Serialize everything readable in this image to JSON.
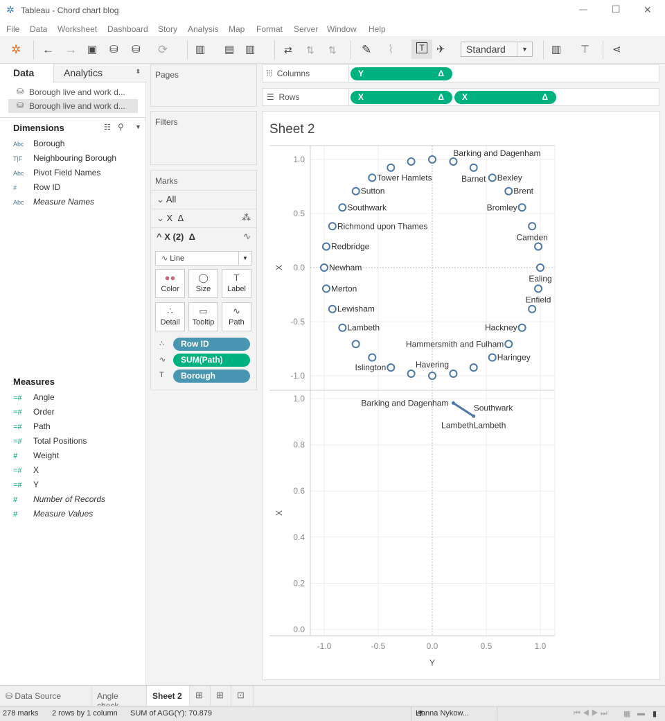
{
  "window": {
    "title": "Tableau - Chord chart blog",
    "minimize": "—",
    "maximize": "☐",
    "close": "✕"
  },
  "menu": [
    "File",
    "Data",
    "Worksheet",
    "Dashboard",
    "Story",
    "Analysis",
    "Map",
    "Format",
    "Server",
    "Window",
    "Help"
  ],
  "toolbar": {
    "fit_select": "Standard"
  },
  "data_pane": {
    "tabs": {
      "data": "Data",
      "analytics": "Analytics"
    },
    "datasources": [
      "Borough live and work d...",
      "Borough live and work d..."
    ],
    "dimensions_title": "Dimensions",
    "dimensions": [
      {
        "icon": "Abc",
        "label": "Borough",
        "italic": false
      },
      {
        "icon": "T|F",
        "label": "Neighbouring Borough",
        "italic": false
      },
      {
        "icon": "Abc",
        "label": "Pivot Field Names",
        "italic": false
      },
      {
        "icon": "#",
        "label": "Row ID",
        "italic": false
      },
      {
        "icon": "Abc",
        "label": "Measure Names",
        "italic": true
      }
    ],
    "measures_title": "Measures",
    "measures": [
      {
        "icon": "=#",
        "label": "Angle",
        "italic": false
      },
      {
        "icon": "=#",
        "label": "Order",
        "italic": false
      },
      {
        "icon": "=#",
        "label": "Path",
        "italic": false
      },
      {
        "icon": "=#",
        "label": "Total Positions",
        "italic": false
      },
      {
        "icon": "#",
        "label": "Weight",
        "italic": false
      },
      {
        "icon": "=#",
        "label": "X",
        "italic": false
      },
      {
        "icon": "=#",
        "label": "Y",
        "italic": false
      },
      {
        "icon": "#",
        "label": "Number of Records",
        "italic": true
      },
      {
        "icon": "#",
        "label": "Measure Values",
        "italic": true
      }
    ]
  },
  "cards": {
    "pages": "Pages",
    "filters": "Filters",
    "marks": "Marks"
  },
  "marks": {
    "all": "All",
    "x1": "X",
    "x2": "X (2)",
    "delta": "Δ",
    "mark_type": "Line",
    "buttons": [
      "Color",
      "Size",
      "Label",
      "Detail",
      "Tooltip",
      "Path"
    ],
    "pills": [
      {
        "icon": "detail",
        "label": "Row ID",
        "color": "#4996b2"
      },
      {
        "icon": "path",
        "label": "SUM(Path)",
        "color": "#00b180"
      },
      {
        "icon": "label",
        "label": "Borough",
        "color": "#4996b2"
      }
    ]
  },
  "shelves": {
    "columns_label": "Columns",
    "rows_label": "Rows",
    "columns": [
      {
        "label": "Y",
        "delta": "Δ"
      }
    ],
    "rows": [
      {
        "label": "X",
        "delta": "Δ"
      },
      {
        "label": "X",
        "delta": "Δ"
      }
    ]
  },
  "sheet": {
    "title": "Sheet 2"
  },
  "chart_data": [
    {
      "type": "scatter",
      "pane": "top",
      "xlabel": "Y",
      "ylabel": "X",
      "xlim": [
        -1.2,
        1.15
      ],
      "ylim": [
        -1.15,
        1.15
      ],
      "yticks": [
        "1.0",
        "0.5",
        "0.0",
        "-0.5",
        "-1.0"
      ],
      "grid": true,
      "marker": "open-circle",
      "color": "#4e79a7",
      "points": [
        {
          "y": 0,
          "x": 1,
          "label": ""
        },
        {
          "y": 0.195,
          "x": 0.981,
          "label": "Barking and Dagenham",
          "side": "above-right"
        },
        {
          "y": 0.383,
          "x": 0.924,
          "label": "Barnet",
          "side": "below"
        },
        {
          "y": 0.556,
          "x": 0.831,
          "label": "Bexley",
          "side": "right"
        },
        {
          "y": 0.707,
          "x": 0.707,
          "label": "Brent",
          "side": "right"
        },
        {
          "y": 0.831,
          "x": 0.556,
          "label": "Bromley",
          "side": "left"
        },
        {
          "y": 0.924,
          "x": 0.383,
          "label": "Camden",
          "side": "below"
        },
        {
          "y": 0.981,
          "x": 0.195,
          "label": ""
        },
        {
          "y": 1,
          "x": 0,
          "label": "Ealing",
          "side": "below"
        },
        {
          "y": 0.981,
          "x": -0.195,
          "label": "Enfield",
          "side": "below"
        },
        {
          "y": 0.924,
          "x": -0.383,
          "label": ""
        },
        {
          "y": 0.831,
          "x": -0.556,
          "label": "Hackney",
          "side": "left"
        },
        {
          "y": 0.707,
          "x": -0.707,
          "label": "Hammersmith and Fulham",
          "side": "left"
        },
        {
          "y": 0.556,
          "x": -0.831,
          "label": "Haringey",
          "side": "right"
        },
        {
          "y": 0.383,
          "x": -0.924,
          "label": ""
        },
        {
          "y": 0.195,
          "x": -0.981,
          "label": ""
        },
        {
          "y": 0,
          "x": -1,
          "label": "Havering",
          "side": "above"
        },
        {
          "y": -0.195,
          "x": -0.981,
          "label": ""
        },
        {
          "y": -0.383,
          "x": -0.924,
          "label": "Islington",
          "side": "left"
        },
        {
          "y": -0.556,
          "x": -0.831,
          "label": ""
        },
        {
          "y": -0.707,
          "x": -0.707,
          "label": ""
        },
        {
          "y": -0.831,
          "x": -0.556,
          "label": "Lambeth",
          "side": "right"
        },
        {
          "y": -0.924,
          "x": -0.383,
          "label": "Lewisham",
          "side": "right"
        },
        {
          "y": -0.981,
          "x": -0.195,
          "label": "Merton",
          "side": "right"
        },
        {
          "y": -1,
          "x": 0,
          "label": "Newham",
          "side": "right"
        },
        {
          "y": -0.981,
          "x": 0.195,
          "label": "Redbridge",
          "side": "right"
        },
        {
          "y": -0.924,
          "x": 0.383,
          "label": "Richmond upon Thames",
          "side": "right"
        },
        {
          "y": -0.831,
          "x": 0.556,
          "label": "Southwark",
          "side": "right"
        },
        {
          "y": -0.707,
          "x": 0.707,
          "label": "Sutton",
          "side": "right"
        },
        {
          "y": -0.556,
          "x": 0.831,
          "label": "Tower Hamlets",
          "side": "right"
        },
        {
          "y": -0.383,
          "x": 0.924,
          "label": ""
        },
        {
          "y": -0.195,
          "x": 0.981,
          "label": ""
        }
      ]
    },
    {
      "type": "line",
      "pane": "bottom",
      "xlabel": "Y",
      "ylabel": "X",
      "xlim": [
        -1.2,
        1.15
      ],
      "ylim": [
        -0.03,
        1.03
      ],
      "xticks": [
        "-1.0",
        "-0.5",
        "0.0",
        "0.5",
        "1.0"
      ],
      "yticks": [
        "1.0",
        "0.8",
        "0.6",
        "0.4",
        "0.2",
        "0.0"
      ],
      "grid": true,
      "color": "#4e79a7",
      "points": [
        {
          "y": 0.195,
          "x": 0.981
        },
        {
          "y": 0.383,
          "x": 0.924
        }
      ],
      "labels": [
        {
          "text": "Barking and Dagenham",
          "y": 0.195,
          "x": 0.981,
          "side": "left"
        },
        {
          "text": "Southwark",
          "y": 0.383,
          "x": 0.924,
          "side": "above-right"
        },
        {
          "text": "Lambeth",
          "y": 0.383,
          "x": 0.924,
          "side": "below-left"
        },
        {
          "text": "Lambeth",
          "y": 0.383,
          "x": 0.924,
          "side": "below-right"
        }
      ]
    }
  ],
  "bottom_tabs": {
    "data_source": "Data Source",
    "tabs": [
      "Angle check",
      "Sheet 2"
    ],
    "active": "Sheet 2"
  },
  "status": {
    "marks": "278 marks",
    "dims": "2 rows by 1 column",
    "sum": "SUM of AGG(Y): 70.879",
    "user": "Hanna Nykow..."
  }
}
